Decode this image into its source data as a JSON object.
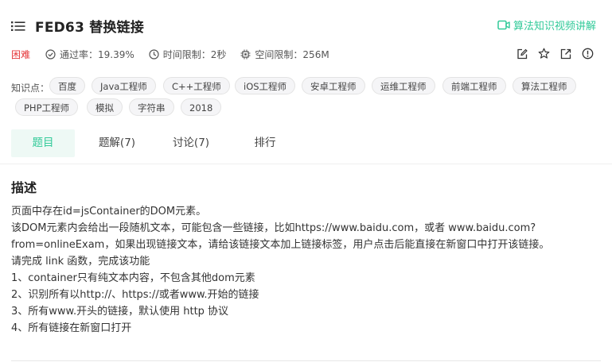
{
  "header": {
    "title": "FED63  替换链接",
    "video_link": "算法知识视频讲解"
  },
  "meta": {
    "difficulty": "困难",
    "pass_rate": "通过率：19.39%",
    "time_limit": "时间限制：2秒",
    "memory_limit": "空间限制：256M"
  },
  "tags": {
    "label": "知识点：",
    "items": [
      "百度",
      "Java工程师",
      "C++工程师",
      "iOS工程师",
      "安卓工程师",
      "运维工程师",
      "前端工程师",
      "算法工程师",
      "PHP工程师",
      "模拟",
      "字符串",
      "2018"
    ]
  },
  "tabs": [
    {
      "label": "题目",
      "active": true
    },
    {
      "label": "题解(7)",
      "active": false
    },
    {
      "label": "讨论(7)",
      "active": false
    },
    {
      "label": "排行",
      "active": false
    }
  ],
  "description": {
    "heading": "描述",
    "lines": [
      "页面中存在id=jsContainer的DOM元素。",
      "该DOM元素内会给出一段随机文本，可能包含一些链接，比如https://www.baidu.com，或者 www.baidu.com?",
      "from=onlineExam，如果出现链接文本，请给该链接文本加上链接标签，用户点击后能直接在新窗口中打开该链接。",
      "请完成 link 函数，完成该功能",
      "1、container只有纯文本内容，不包含其他dom元素",
      "2、识别所有以http://、https://或者www.开始的链接",
      "3、所有www.开头的链接，默认使用 http 协议",
      "4、所有链接在新窗口打开"
    ]
  },
  "colors": {
    "accent": "#32ca99",
    "difficulty": "#e5373a"
  }
}
